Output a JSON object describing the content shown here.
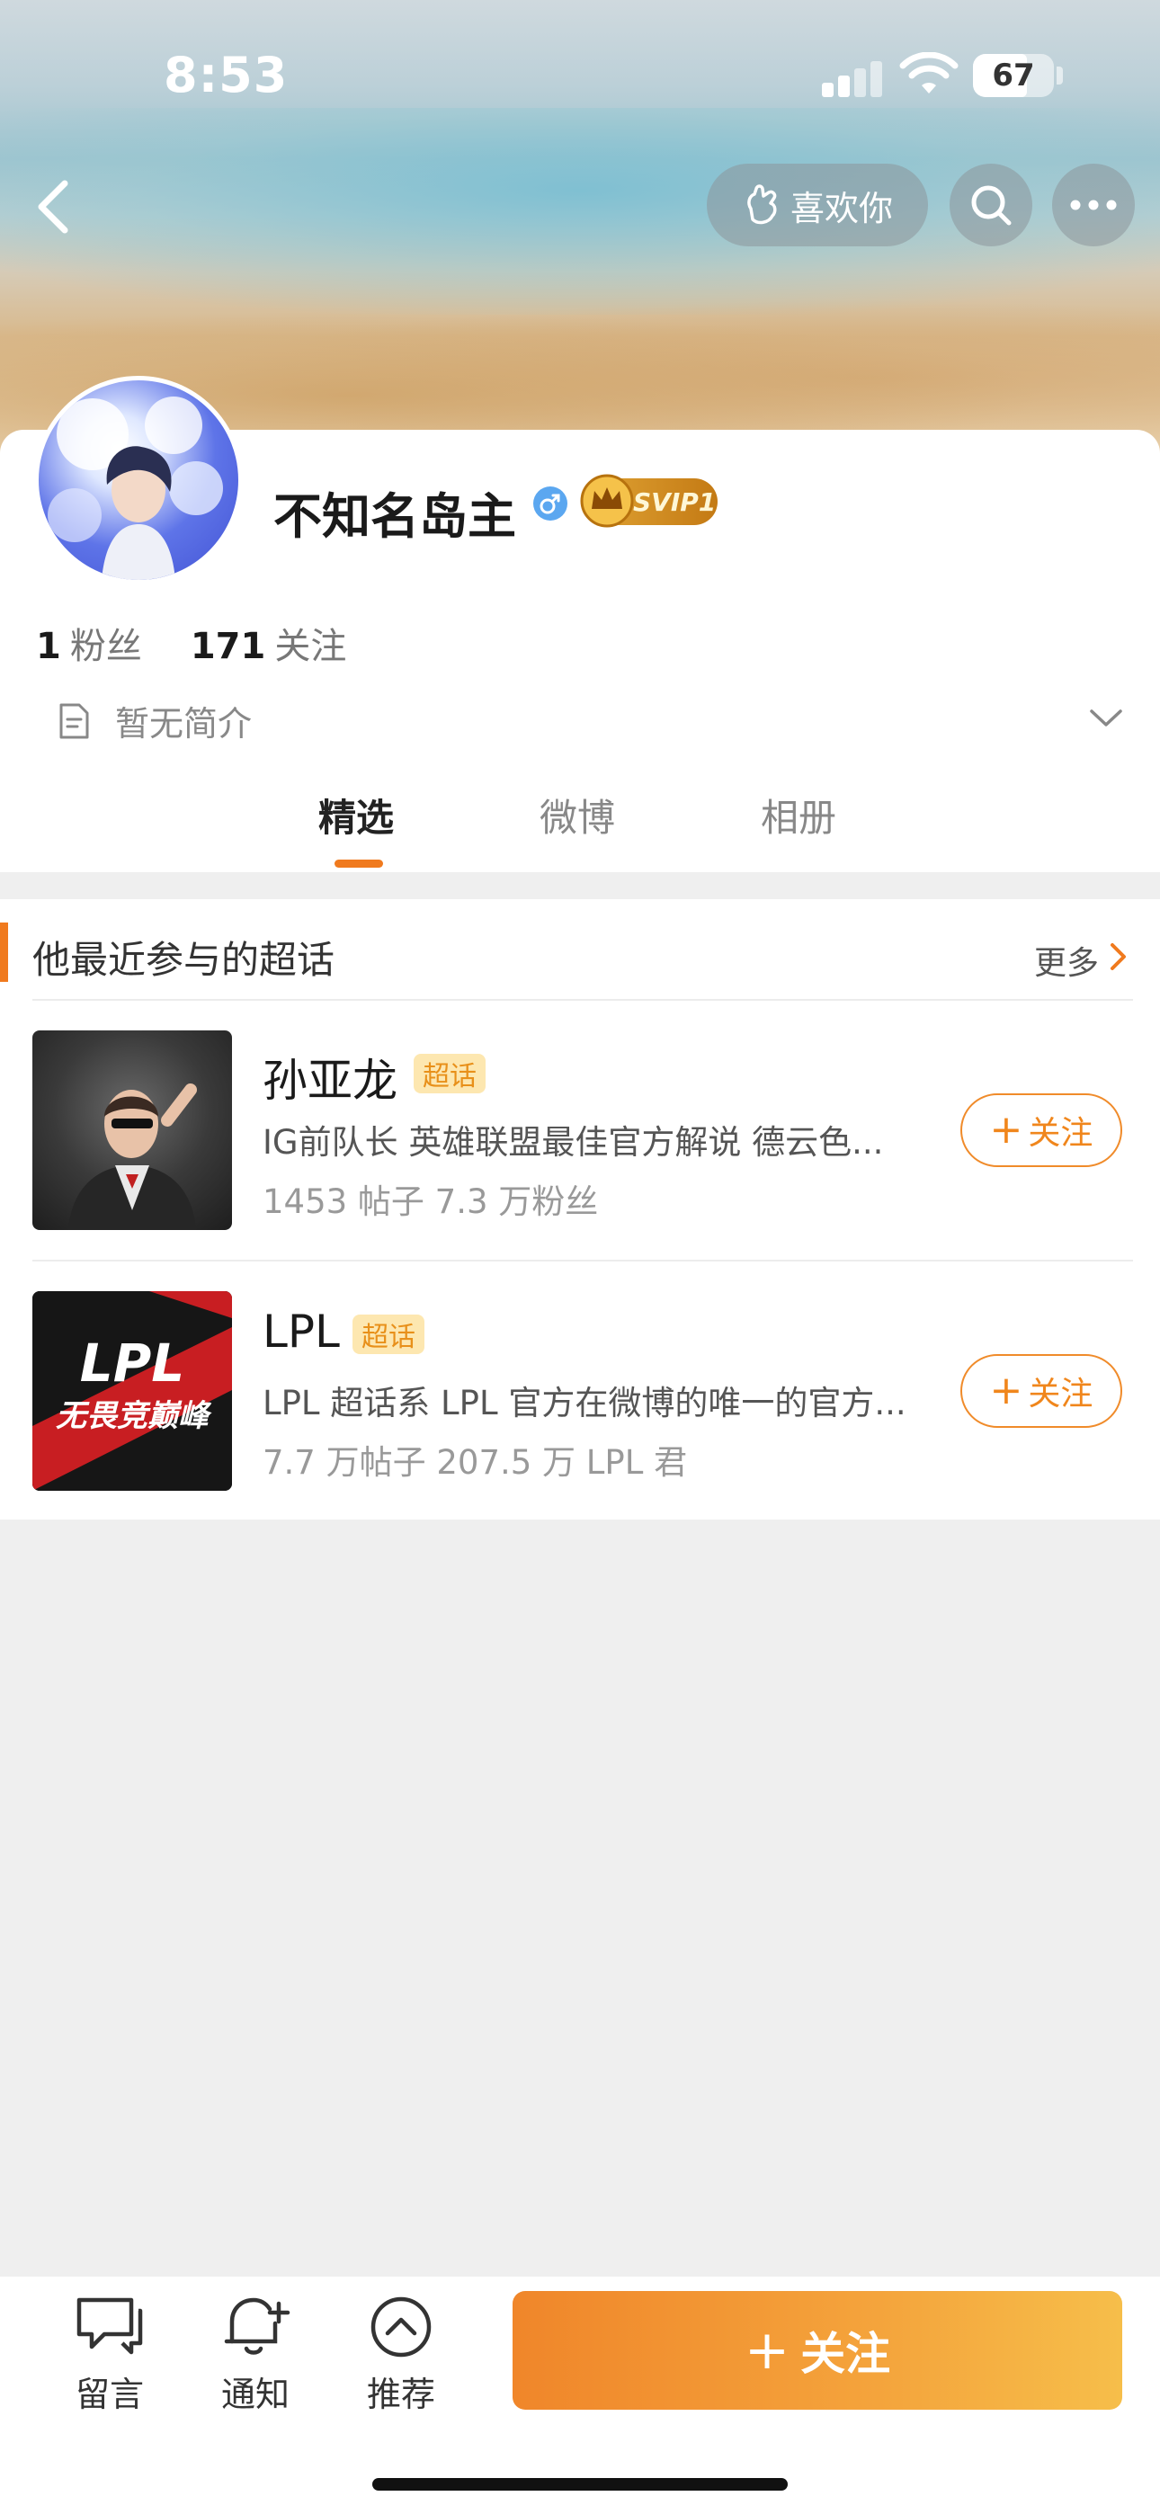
{
  "status_bar": {
    "time": "8:53",
    "battery": "67",
    "battery_fraction": 0.67
  },
  "header": {
    "like_label": "喜欢你"
  },
  "profile": {
    "name": "不知名岛主",
    "gender": "male",
    "vip_badge": "SVIP1",
    "fans_count": "1",
    "fans_label": "粉丝",
    "following_count": "171",
    "following_label": "关注",
    "bio": "暂无简介"
  },
  "tabs": [
    {
      "label": "精选",
      "active": true
    },
    {
      "label": "微博",
      "active": false
    },
    {
      "label": "相册",
      "active": false
    }
  ],
  "super_topics": {
    "title": "他最近参与的超话",
    "more_label": "更多",
    "items": [
      {
        "name": "孙亚龙",
        "tag": "超话",
        "description": "IG前队长 英雄联盟最佳官方解说 德云色...",
        "meta": "1453 帖子 7.3 万粉丝",
        "follow_label": "关注"
      },
      {
        "name": "LPL",
        "tag": "超话",
        "description": "LPL 超话系 LPL 官方在微博的唯一的官方...",
        "meta": "7.7 万帖子 207.5 万 LPL 君",
        "follow_label": "关注",
        "logo_text": "LPL",
        "logo_subtext": "无畏竞巅峰"
      }
    ]
  },
  "bottom_bar": {
    "message_label": "留言",
    "notify_label": "通知",
    "recommend_label": "推荐",
    "follow_label": "关注"
  },
  "colors": {
    "accent": "#f07a1e",
    "tag_bg": "#fde7b0",
    "tag_text": "#e8901a"
  },
  "icons": [
    "back-icon",
    "like-hand-icon",
    "search-icon",
    "more-icon",
    "document-icon",
    "chevron-down-icon",
    "chevron-right-icon",
    "message-icon",
    "bell-plus-icon",
    "chevron-up-circle-icon",
    "male-icon",
    "crown-icon"
  ]
}
